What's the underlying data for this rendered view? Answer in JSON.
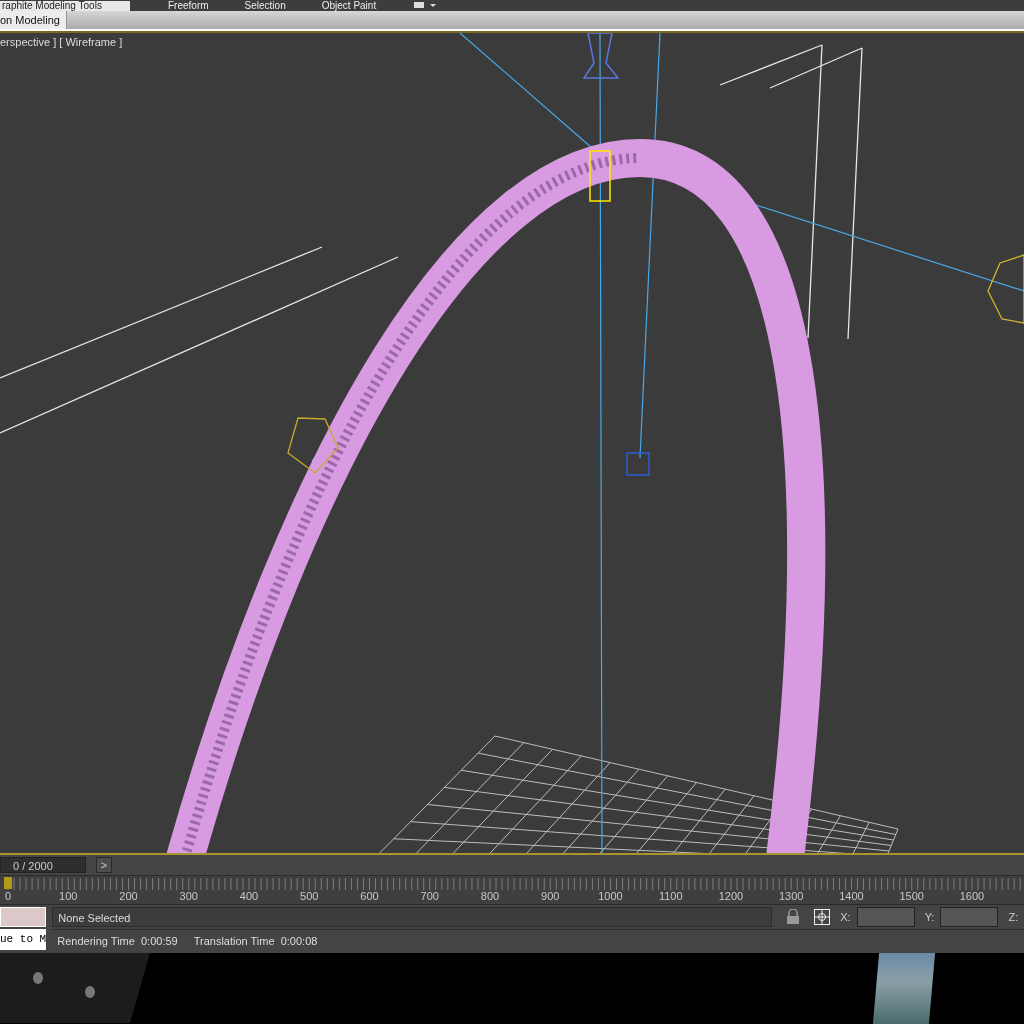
{
  "ribbon": {
    "tabs": [
      {
        "label": "raphite Modeling Tools",
        "selected": true
      },
      {
        "label": "Freeform",
        "selected": false
      },
      {
        "label": "Selection",
        "selected": false
      },
      {
        "label": "Object Paint",
        "selected": false
      }
    ],
    "panel_tab": "on Modeling"
  },
  "viewport": {
    "label": "erspective ] [ Wireframe ]"
  },
  "time_slider": {
    "frame": "0 / 2000",
    "next": ">",
    "level": 0
  },
  "track_bar": {
    "ticks": [
      "0",
      "100",
      "200",
      "300",
      "400",
      "500",
      "600",
      "700",
      "800",
      "900",
      "1000",
      "1100",
      "1200",
      "1300",
      "1400",
      "1500",
      "1600"
    ]
  },
  "status": {
    "listener_value": "ue to M",
    "prompt": "None Selected",
    "selection_lock": false,
    "coords": [
      {
        "label": "X:"
      },
      {
        "label": "Y:"
      },
      {
        "label": "Z:"
      }
    ],
    "info": [
      {
        "label": "Rendering Time",
        "value": "0:00:59"
      },
      {
        "label": "Translation Time",
        "value": "0:00:08"
      }
    ]
  }
}
